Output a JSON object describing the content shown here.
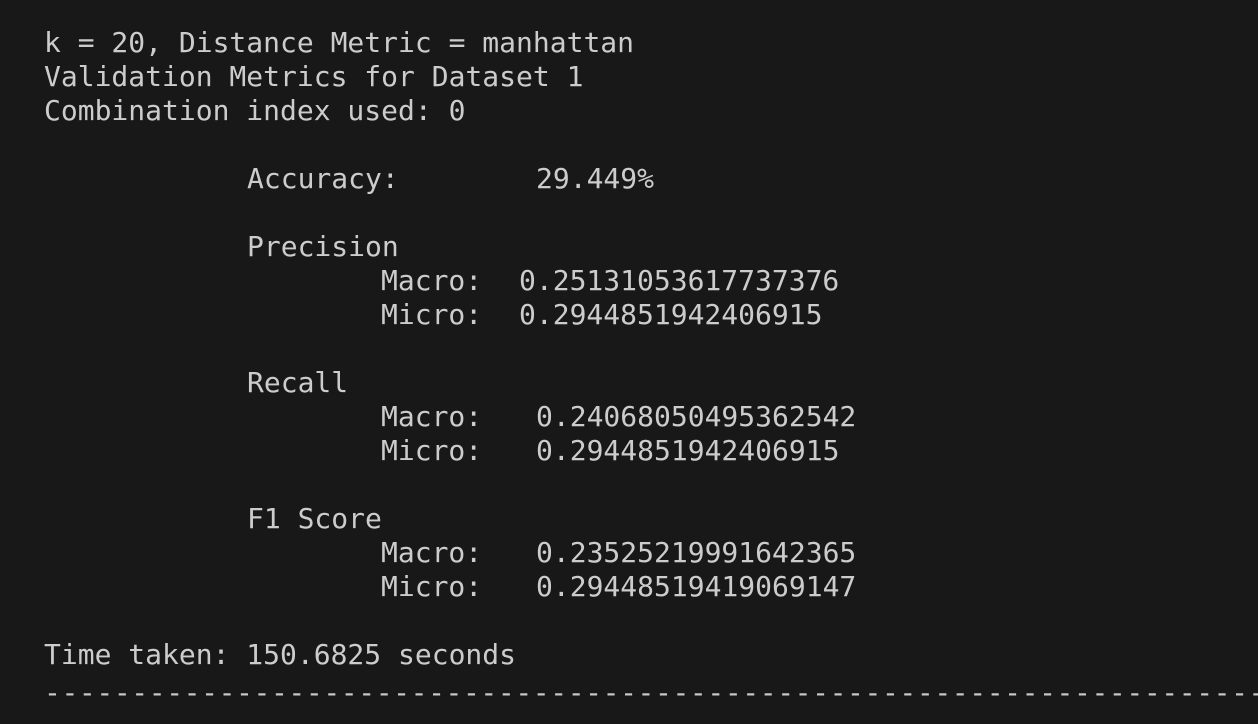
{
  "output": {
    "header": {
      "params_line": "k = 20, Distance Metric = manhattan",
      "validation_line": "Validation Metrics for Dataset 1",
      "combination_line": "Combination index used: 0"
    },
    "accuracy": {
      "label": "Accuracy:",
      "value": "29.449%"
    },
    "precision": {
      "title": "Precision",
      "macro_label": "Macro:",
      "macro_value": "0.25131053617737376",
      "micro_label": "Micro:",
      "micro_value": "0.2944851942406915"
    },
    "recall": {
      "title": "Recall",
      "macro_label": "Macro:",
      "macro_value": "0.24068050495362542",
      "micro_label": "Micro:",
      "micro_value": "0.2944851942406915"
    },
    "f1": {
      "title": "F1 Score",
      "macro_label": "Macro:",
      "macro_value": "0.23525219991642365",
      "micro_label": "Micro:",
      "micro_value": "0.29448519419069147"
    },
    "time_line": "Time taken: 150.6825 seconds",
    "separator": "----------------------------------------------------------------------"
  },
  "colors": {
    "background": "#181818",
    "text": "#cccccc"
  }
}
